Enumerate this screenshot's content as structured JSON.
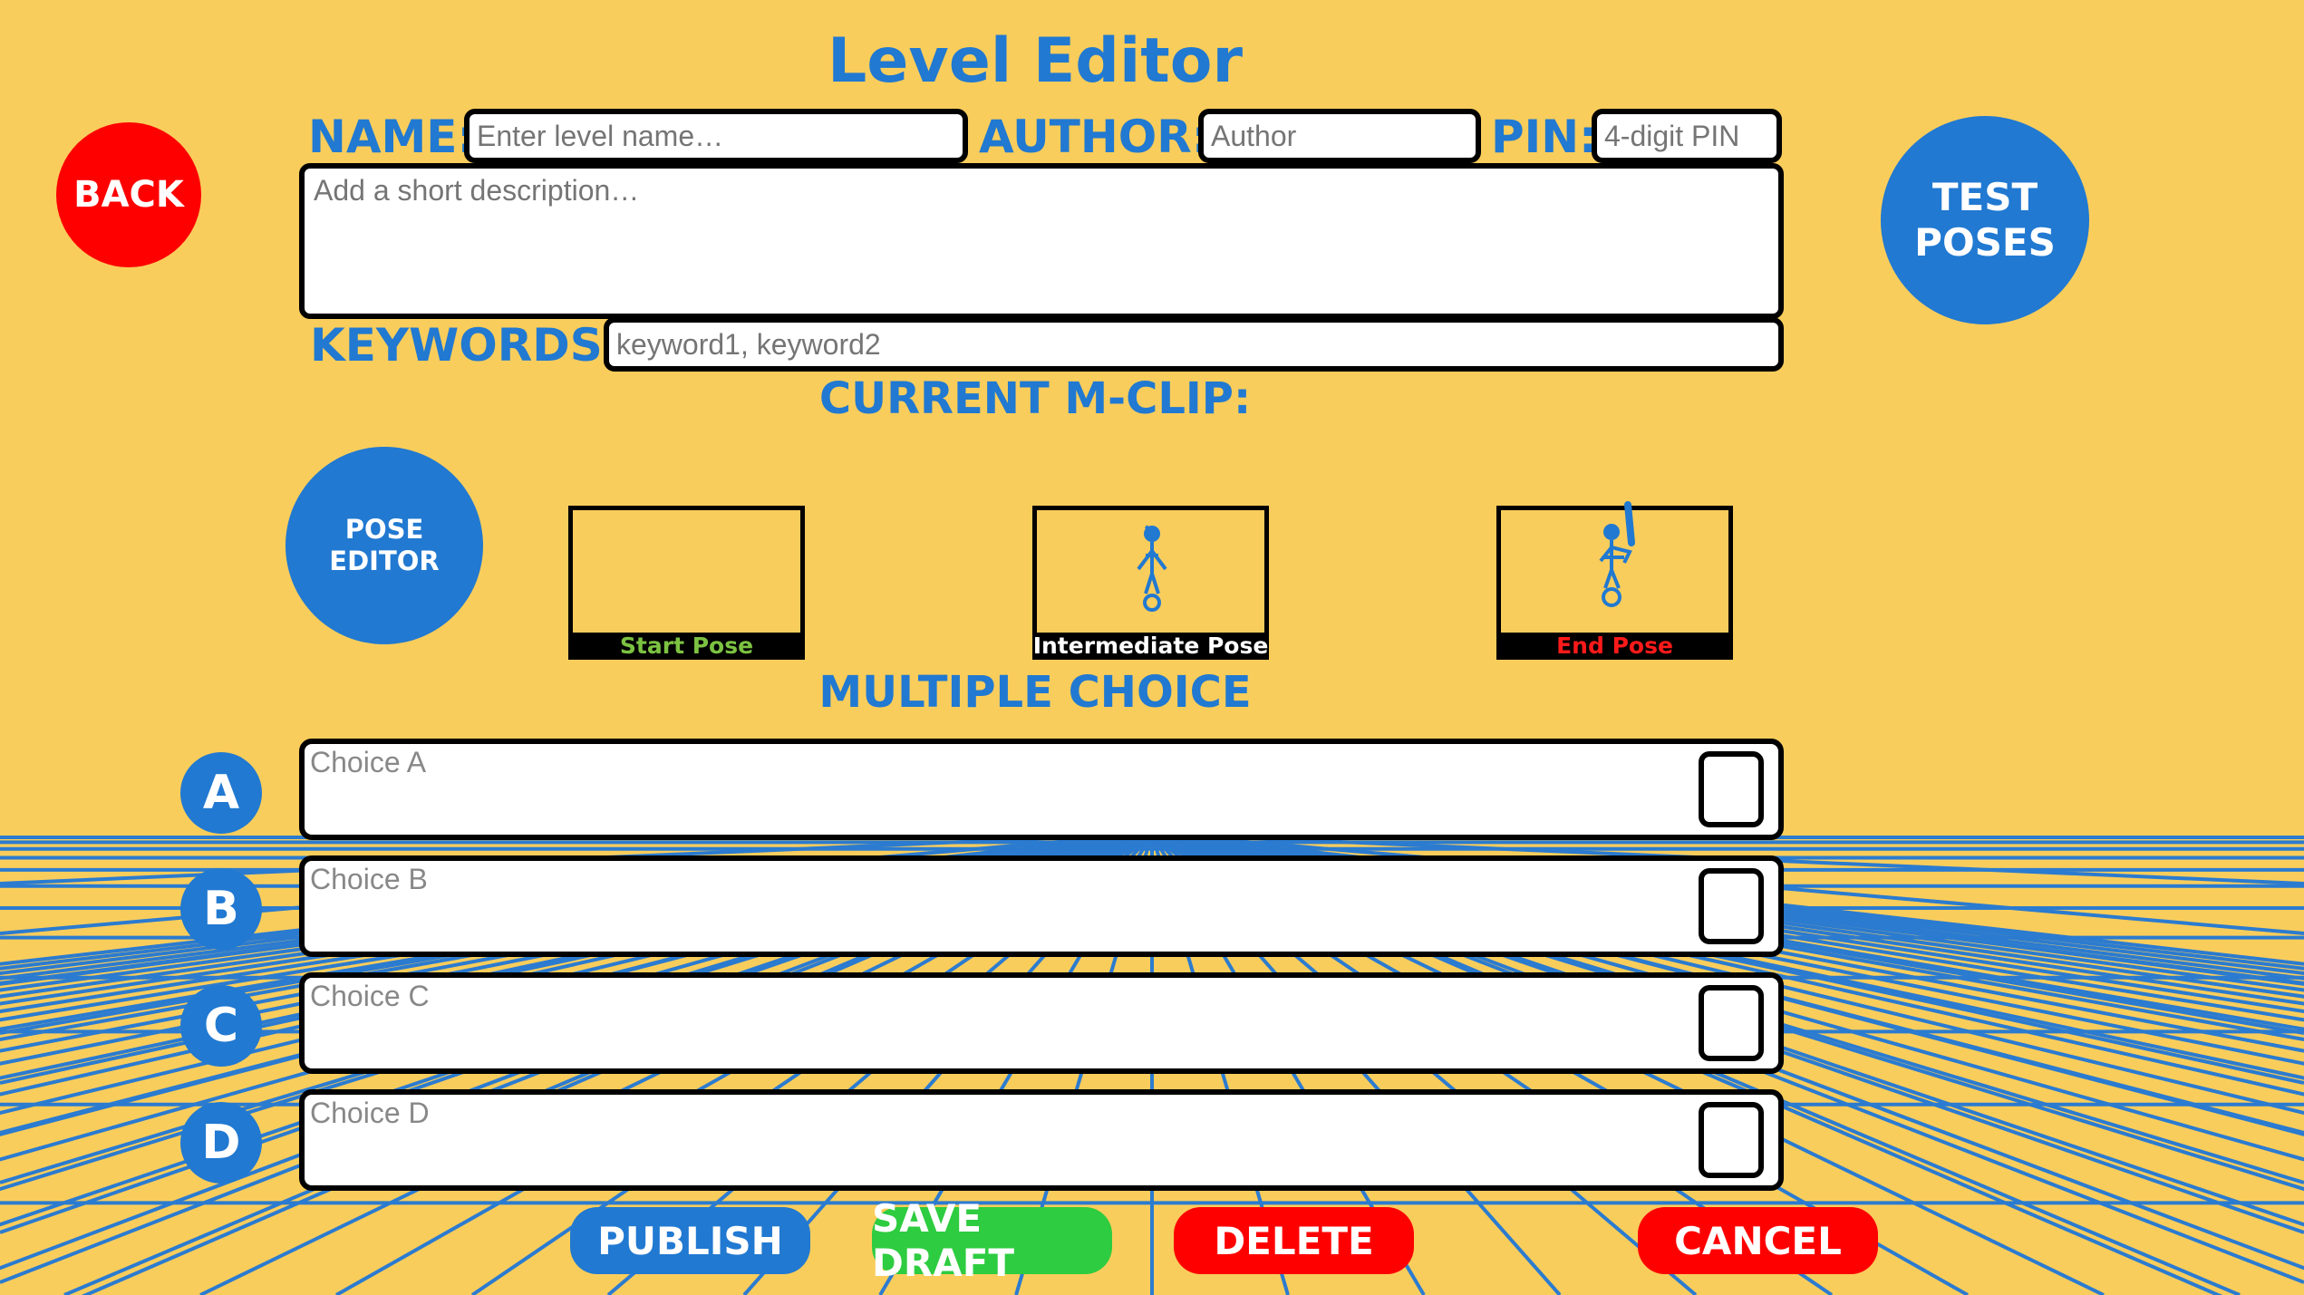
{
  "title": "Level Editor",
  "header": {
    "name_label": "NAME:",
    "name_placeholder": "Enter level name…",
    "author_label": "AUTHOR:",
    "author_placeholder": "Author",
    "pin_label": "PIN:",
    "pin_placeholder": "4-digit PIN",
    "description_placeholder": "Add a short description…",
    "keywords_label": "KEYWORDS:",
    "keywords_placeholder": "keyword1, keyword2"
  },
  "buttons": {
    "back": "BACK",
    "test_poses_line1": "TEST",
    "test_poses_line2": "POSES",
    "pose_editor_line1": "POSE",
    "pose_editor_line2": "EDITOR"
  },
  "mclip": {
    "heading": "CURRENT M-CLIP:",
    "poses": [
      {
        "caption": "Start Pose",
        "color": "#7CC242"
      },
      {
        "caption": "Intermediate Pose",
        "color": "#FFFFFF"
      },
      {
        "caption": "End Pose",
        "color": "#FF1A1A"
      }
    ]
  },
  "multiple_choice": {
    "heading": "MULTIPLE CHOICE",
    "choices": [
      {
        "letter": "A",
        "placeholder": "Choice A"
      },
      {
        "letter": "B",
        "placeholder": "Choice B"
      },
      {
        "letter": "C",
        "placeholder": "Choice C"
      },
      {
        "letter": "D",
        "placeholder": "Choice D"
      }
    ]
  },
  "actions": {
    "publish": "PUBLISH",
    "save_draft": "SAVE DRAFT",
    "delete": "DELETE",
    "cancel": "CANCEL"
  },
  "colors": {
    "background": "#F9CD5C",
    "accent_blue": "#2179D1",
    "danger_red": "#FF0000",
    "success_green": "#2ECC40",
    "grid_line": "#2B7BD0"
  }
}
